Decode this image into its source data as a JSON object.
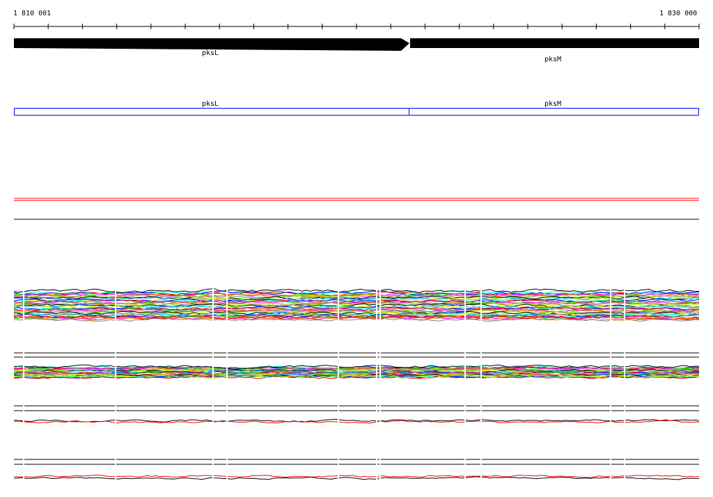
{
  "ruler": {
    "start_label": "1 810 001",
    "end_label": "1 830 000",
    "start": 1810001,
    "end": 1830000,
    "tick_count": 21
  },
  "genes": [
    {
      "name": "pksL",
      "strand": "+"
    },
    {
      "name": "pksM",
      "strand": "+"
    }
  ],
  "annotation_track": [
    {
      "name": "pksL"
    },
    {
      "name": "pksM"
    }
  ],
  "colors": {
    "gene": "#000000",
    "annotation": "#0000ff",
    "marker": "#ff0000",
    "series": [
      "#00ffff",
      "#0000ff",
      "#ff0000",
      "#00ff00",
      "#ff00ff",
      "#ff8000",
      "#808080",
      "#a0ff00",
      "#000000",
      "#0080ff",
      "#ffff00"
    ]
  }
}
